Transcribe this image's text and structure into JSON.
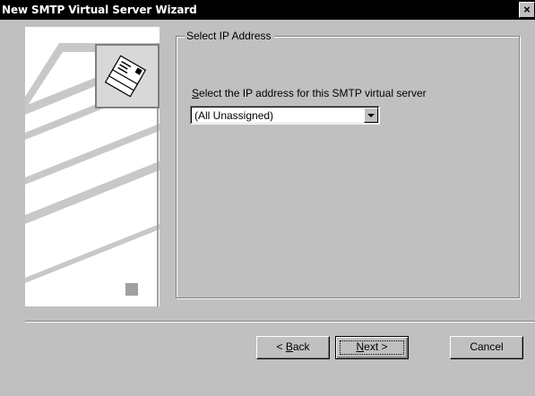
{
  "window": {
    "title": "New SMTP Virtual Server Wizard",
    "close_glyph": "×"
  },
  "page": {
    "group_title": "Select IP Address",
    "ip_label_accel": "S",
    "ip_label_rest": "elect the IP address for this SMTP virtual server",
    "ip_selected": "(All Unassigned)"
  },
  "buttons": {
    "back_prefix": "< ",
    "back_accel": "B",
    "back_rest": "ack",
    "next_accel": "N",
    "next_rest": "ext >",
    "cancel": "Cancel"
  },
  "icons": {
    "wizard_art": "server-illustration",
    "mail_icon": "mail-stack-icon",
    "dropdown": "chevron-down-icon",
    "close": "close-icon"
  }
}
